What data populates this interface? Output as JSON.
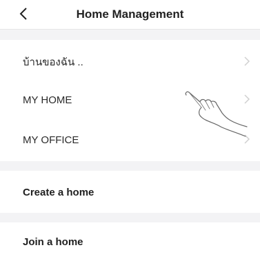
{
  "header": {
    "title": "Home Management",
    "back_icon": "chevron-left-icon"
  },
  "homes": [
    {
      "label": "บ้านของฉัน .."
    },
    {
      "label": "MY HOME"
    },
    {
      "label": "MY OFFICE"
    }
  ],
  "actions": {
    "create": "Create a home",
    "join": "Join a home"
  },
  "colors": {
    "background": "#f4f4f6",
    "card": "#ffffff",
    "chevron": "#c8c8c8"
  }
}
